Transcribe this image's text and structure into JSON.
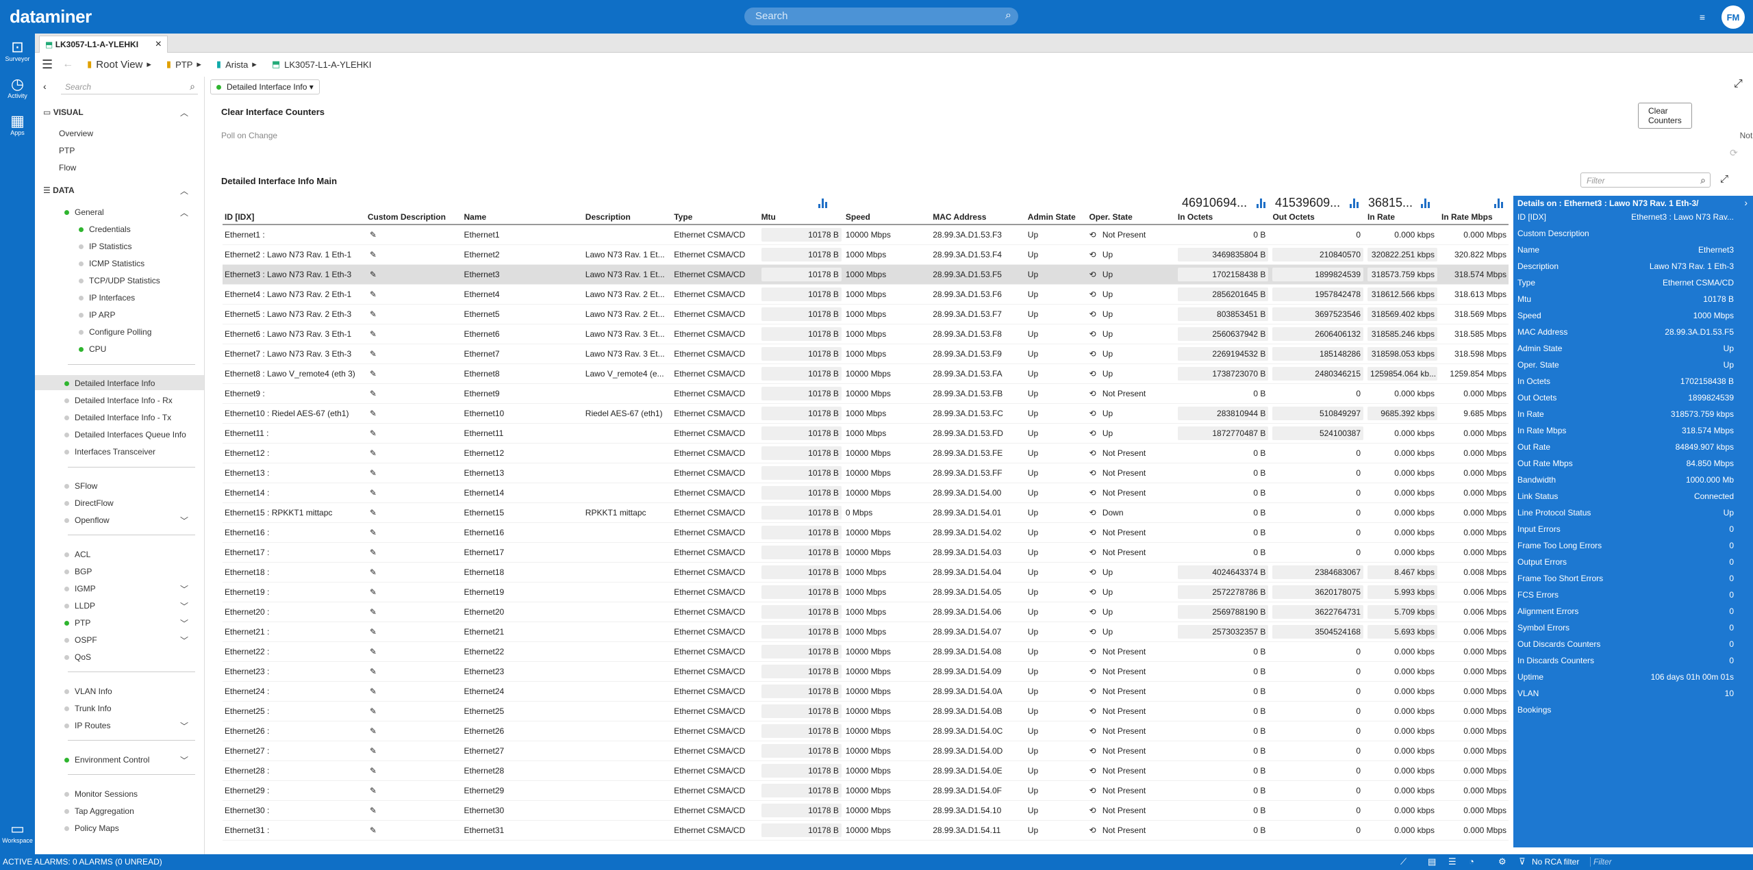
{
  "app": {
    "brand": "dataminer",
    "search_placeholder": "Search",
    "user_initials": "FM"
  },
  "rail": [
    {
      "label": "Surveyor"
    },
    {
      "label": "Activity"
    },
    {
      "label": "Apps"
    },
    {
      "label": "Workspace"
    }
  ],
  "tab": {
    "label": "LK3057-L1-A-YLEHKI"
  },
  "breadcrumb": [
    "Root View",
    "PTP",
    "Arista",
    "LK3057-L1-A-YLEHKI"
  ],
  "left": {
    "search_placeholder": "Search",
    "visual_header": "VISUAL",
    "visual_items": [
      "Overview",
      "PTP",
      "Flow"
    ],
    "data_header": "DATA",
    "general": "General",
    "general_items": [
      "Credentials",
      "IP Statistics",
      "ICMP Statistics",
      "TCP/UDP Statistics",
      "IP Interfaces",
      "IP ARP",
      "Configure Polling",
      "CPU"
    ],
    "detail_items": [
      "Detailed Interface Info",
      "Detailed Interface Info - Rx",
      "Detailed Interface Info - Tx",
      "Detailed Interfaces Queue Info",
      "Interfaces Transceiver"
    ],
    "flow_items": [
      "SFlow",
      "DirectFlow",
      "Openflow"
    ],
    "proto_items": [
      "ACL",
      "BGP",
      "IGMP",
      "LLDP",
      "PTP",
      "OSPF",
      "QoS"
    ],
    "vlan_items": [
      "VLAN Info",
      "Trunk Info",
      "IP Routes"
    ],
    "env_item": "Environment Control",
    "mon_items": [
      "Monitor Sessions",
      "Tap Aggregation",
      "Policy Maps"
    ]
  },
  "content": {
    "page_dropdown": "Detailed Interface Info",
    "clear_title": "Clear Interface Counters",
    "clear_button": "Clear Counters",
    "poll_label": "Poll on Change",
    "poll_value": "Not initialized",
    "table_title": "Detailed Interface Info Main",
    "filter_placeholder": "Filter",
    "totals": {
      "in_octets": "46910694...",
      "out_octets": "41539609...",
      "in_rate": "36815..."
    },
    "columns": [
      "ID [IDX]",
      "Custom Description",
      "Name",
      "Description",
      "Type",
      "Mtu",
      "Speed",
      "MAC Address",
      "Admin State",
      "Oper. State",
      "In Octets",
      "Out Octets",
      "In Rate",
      "In Rate Mbps"
    ],
    "rows": [
      [
        "Ethernet1 :",
        "",
        "Ethernet1",
        "",
        "Ethernet CSMA/CD",
        "10178 B",
        "10000 Mbps",
        "28.99.3A.D1.53.F3",
        "Up",
        "Not Present",
        "0 B",
        "0",
        "0.000 kbps",
        "0.000 Mbps"
      ],
      [
        "Ethernet2 : Lawo N73 Rav. 1 Eth-1",
        "",
        "Ethernet2",
        "Lawo N73 Rav. 1 Et...",
        "Ethernet CSMA/CD",
        "10178 B",
        "1000 Mbps",
        "28.99.3A.D1.53.F4",
        "Up",
        "Up",
        "3469835804 B",
        "210840570",
        "320822.251 kbps",
        "320.822 Mbps"
      ],
      [
        "Ethernet3 : Lawo N73 Rav. 1 Eth-3",
        "",
        "Ethernet3",
        "Lawo N73 Rav. 1 Et...",
        "Ethernet CSMA/CD",
        "10178 B",
        "1000 Mbps",
        "28.99.3A.D1.53.F5",
        "Up",
        "Up",
        "1702158438 B",
        "1899824539",
        "318573.759 kbps",
        "318.574 Mbps"
      ],
      [
        "Ethernet4 : Lawo N73 Rav. 2 Eth-1",
        "",
        "Ethernet4",
        "Lawo N73 Rav. 2 Et...",
        "Ethernet CSMA/CD",
        "10178 B",
        "1000 Mbps",
        "28.99.3A.D1.53.F6",
        "Up",
        "Up",
        "2856201645 B",
        "1957842478",
        "318612.566 kbps",
        "318.613 Mbps"
      ],
      [
        "Ethernet5 : Lawo N73 Rav. 2 Eth-3",
        "",
        "Ethernet5",
        "Lawo N73 Rav. 2 Et...",
        "Ethernet CSMA/CD",
        "10178 B",
        "1000 Mbps",
        "28.99.3A.D1.53.F7",
        "Up",
        "Up",
        "803853451 B",
        "3697523546",
        "318569.402 kbps",
        "318.569 Mbps"
      ],
      [
        "Ethernet6 : Lawo N73 Rav. 3 Eth-1",
        "",
        "Ethernet6",
        "Lawo N73 Rav. 3 Et...",
        "Ethernet CSMA/CD",
        "10178 B",
        "1000 Mbps",
        "28.99.3A.D1.53.F8",
        "Up",
        "Up",
        "2560637942 B",
        "2606406132",
        "318585.246 kbps",
        "318.585 Mbps"
      ],
      [
        "Ethernet7 : Lawo N73 Rav. 3 Eth-3",
        "",
        "Ethernet7",
        "Lawo N73 Rav. 3 Et...",
        "Ethernet CSMA/CD",
        "10178 B",
        "1000 Mbps",
        "28.99.3A.D1.53.F9",
        "Up",
        "Up",
        "2269194532 B",
        "185148286",
        "318598.053 kbps",
        "318.598 Mbps"
      ],
      [
        "Ethernet8 : Lawo V_remote4 (eth 3)",
        "",
        "Ethernet8",
        "Lawo V_remote4 (e...",
        "Ethernet CSMA/CD",
        "10178 B",
        "10000 Mbps",
        "28.99.3A.D1.53.FA",
        "Up",
        "Up",
        "1738723070 B",
        "2480346215",
        "1259854.064 kb...",
        "1259.854 Mbps"
      ],
      [
        "Ethernet9 :",
        "",
        "Ethernet9",
        "",
        "Ethernet CSMA/CD",
        "10178 B",
        "10000 Mbps",
        "28.99.3A.D1.53.FB",
        "Up",
        "Not Present",
        "0 B",
        "0",
        "0.000 kbps",
        "0.000 Mbps"
      ],
      [
        "Ethernet10 : Riedel AES-67 (eth1)",
        "",
        "Ethernet10",
        "Riedel AES-67 (eth1)",
        "Ethernet CSMA/CD",
        "10178 B",
        "1000 Mbps",
        "28.99.3A.D1.53.FC",
        "Up",
        "Up",
        "283810944 B",
        "510849297",
        "9685.392 kbps",
        "9.685 Mbps"
      ],
      [
        "Ethernet11 :",
        "",
        "Ethernet11",
        "",
        "Ethernet CSMA/CD",
        "10178 B",
        "1000 Mbps",
        "28.99.3A.D1.53.FD",
        "Up",
        "Up",
        "1872770487 B",
        "524100387",
        "0.000 kbps",
        "0.000 Mbps"
      ],
      [
        "Ethernet12 :",
        "",
        "Ethernet12",
        "",
        "Ethernet CSMA/CD",
        "10178 B",
        "10000 Mbps",
        "28.99.3A.D1.53.FE",
        "Up",
        "Not Present",
        "0 B",
        "0",
        "0.000 kbps",
        "0.000 Mbps"
      ],
      [
        "Ethernet13 :",
        "",
        "Ethernet13",
        "",
        "Ethernet CSMA/CD",
        "10178 B",
        "10000 Mbps",
        "28.99.3A.D1.53.FF",
        "Up",
        "Not Present",
        "0 B",
        "0",
        "0.000 kbps",
        "0.000 Mbps"
      ],
      [
        "Ethernet14 :",
        "",
        "Ethernet14",
        "",
        "Ethernet CSMA/CD",
        "10178 B",
        "10000 Mbps",
        "28.99.3A.D1.54.00",
        "Up",
        "Not Present",
        "0 B",
        "0",
        "0.000 kbps",
        "0.000 Mbps"
      ],
      [
        "Ethernet15 : RPKKT1 mittapc",
        "",
        "Ethernet15",
        "RPKKT1 mittapc",
        "Ethernet CSMA/CD",
        "10178 B",
        "0 Mbps",
        "28.99.3A.D1.54.01",
        "Up",
        "Down",
        "0 B",
        "0",
        "0.000 kbps",
        "0.000 Mbps"
      ],
      [
        "Ethernet16 :",
        "",
        "Ethernet16",
        "",
        "Ethernet CSMA/CD",
        "10178 B",
        "10000 Mbps",
        "28.99.3A.D1.54.02",
        "Up",
        "Not Present",
        "0 B",
        "0",
        "0.000 kbps",
        "0.000 Mbps"
      ],
      [
        "Ethernet17 :",
        "",
        "Ethernet17",
        "",
        "Ethernet CSMA/CD",
        "10178 B",
        "10000 Mbps",
        "28.99.3A.D1.54.03",
        "Up",
        "Not Present",
        "0 B",
        "0",
        "0.000 kbps",
        "0.000 Mbps"
      ],
      [
        "Ethernet18 :",
        "",
        "Ethernet18",
        "",
        "Ethernet CSMA/CD",
        "10178 B",
        "1000 Mbps",
        "28.99.3A.D1.54.04",
        "Up",
        "Up",
        "4024643374 B",
        "2384683067",
        "8.467 kbps",
        "0.008 Mbps"
      ],
      [
        "Ethernet19 :",
        "",
        "Ethernet19",
        "",
        "Ethernet CSMA/CD",
        "10178 B",
        "1000 Mbps",
        "28.99.3A.D1.54.05",
        "Up",
        "Up",
        "2572278786 B",
        "3620178075",
        "5.993 kbps",
        "0.006 Mbps"
      ],
      [
        "Ethernet20 :",
        "",
        "Ethernet20",
        "",
        "Ethernet CSMA/CD",
        "10178 B",
        "1000 Mbps",
        "28.99.3A.D1.54.06",
        "Up",
        "Up",
        "2569788190 B",
        "3622764731",
        "5.709 kbps",
        "0.006 Mbps"
      ],
      [
        "Ethernet21 :",
        "",
        "Ethernet21",
        "",
        "Ethernet CSMA/CD",
        "10178 B",
        "1000 Mbps",
        "28.99.3A.D1.54.07",
        "Up",
        "Up",
        "2573032357 B",
        "3504524168",
        "5.693 kbps",
        "0.006 Mbps"
      ],
      [
        "Ethernet22 :",
        "",
        "Ethernet22",
        "",
        "Ethernet CSMA/CD",
        "10178 B",
        "10000 Mbps",
        "28.99.3A.D1.54.08",
        "Up",
        "Not Present",
        "0 B",
        "0",
        "0.000 kbps",
        "0.000 Mbps"
      ],
      [
        "Ethernet23 :",
        "",
        "Ethernet23",
        "",
        "Ethernet CSMA/CD",
        "10178 B",
        "10000 Mbps",
        "28.99.3A.D1.54.09",
        "Up",
        "Not Present",
        "0 B",
        "0",
        "0.000 kbps",
        "0.000 Mbps"
      ],
      [
        "Ethernet24 :",
        "",
        "Ethernet24",
        "",
        "Ethernet CSMA/CD",
        "10178 B",
        "10000 Mbps",
        "28.99.3A.D1.54.0A",
        "Up",
        "Not Present",
        "0 B",
        "0",
        "0.000 kbps",
        "0.000 Mbps"
      ],
      [
        "Ethernet25 :",
        "",
        "Ethernet25",
        "",
        "Ethernet CSMA/CD",
        "10178 B",
        "10000 Mbps",
        "28.99.3A.D1.54.0B",
        "Up",
        "Not Present",
        "0 B",
        "0",
        "0.000 kbps",
        "0.000 Mbps"
      ],
      [
        "Ethernet26 :",
        "",
        "Ethernet26",
        "",
        "Ethernet CSMA/CD",
        "10178 B",
        "10000 Mbps",
        "28.99.3A.D1.54.0C",
        "Up",
        "Not Present",
        "0 B",
        "0",
        "0.000 kbps",
        "0.000 Mbps"
      ],
      [
        "Ethernet27 :",
        "",
        "Ethernet27",
        "",
        "Ethernet CSMA/CD",
        "10178 B",
        "10000 Mbps",
        "28.99.3A.D1.54.0D",
        "Up",
        "Not Present",
        "0 B",
        "0",
        "0.000 kbps",
        "0.000 Mbps"
      ],
      [
        "Ethernet28 :",
        "",
        "Ethernet28",
        "",
        "Ethernet CSMA/CD",
        "10178 B",
        "10000 Mbps",
        "28.99.3A.D1.54.0E",
        "Up",
        "Not Present",
        "0 B",
        "0",
        "0.000 kbps",
        "0.000 Mbps"
      ],
      [
        "Ethernet29 :",
        "",
        "Ethernet29",
        "",
        "Ethernet CSMA/CD",
        "10178 B",
        "10000 Mbps",
        "28.99.3A.D1.54.0F",
        "Up",
        "Not Present",
        "0 B",
        "0",
        "0.000 kbps",
        "0.000 Mbps"
      ],
      [
        "Ethernet30 :",
        "",
        "Ethernet30",
        "",
        "Ethernet CSMA/CD",
        "10178 B",
        "10000 Mbps",
        "28.99.3A.D1.54.10",
        "Up",
        "Not Present",
        "0 B",
        "0",
        "0.000 kbps",
        "0.000 Mbps"
      ],
      [
        "Ethernet31 :",
        "",
        "Ethernet31",
        "",
        "Ethernet CSMA/CD",
        "10178 B",
        "10000 Mbps",
        "28.99.3A.D1.54.11",
        "Up",
        "Not Present",
        "0 B",
        "0",
        "0.000 kbps",
        "0.000 Mbps"
      ]
    ],
    "selected_row": 2
  },
  "details": {
    "title": "Details on : Ethernet3 : Lawo N73 Rav. 1 Eth-3/",
    "fields": [
      [
        "ID [IDX]",
        "Ethernet3 : Lawo N73 Rav..."
      ],
      [
        "Custom Description",
        ""
      ],
      [
        "Name",
        "Ethernet3"
      ],
      [
        "Description",
        "Lawo N73 Rav. 1 Eth-3"
      ],
      [
        "Type",
        "Ethernet CSMA/CD"
      ],
      [
        "Mtu",
        "10178 B"
      ],
      [
        "Speed",
        "1000 Mbps"
      ],
      [
        "MAC Address",
        "28.99.3A.D1.53.F5"
      ],
      [
        "Admin State",
        "Up"
      ],
      [
        "Oper. State",
        "Up"
      ],
      [
        "In Octets",
        "1702158438 B"
      ],
      [
        "Out Octets",
        "1899824539"
      ],
      [
        "In Rate",
        "318573.759 kbps"
      ],
      [
        "In Rate Mbps",
        "318.574 Mbps"
      ],
      [
        "Out Rate",
        "84849.907 kbps"
      ],
      [
        "Out Rate Mbps",
        "84.850 Mbps"
      ],
      [
        "Bandwidth",
        "1000.000 Mb"
      ],
      [
        "Link Status",
        "Connected"
      ],
      [
        "Line Protocol Status",
        "Up"
      ],
      [
        "Input Errors",
        "0"
      ],
      [
        "Frame Too Long Errors",
        "0"
      ],
      [
        "Output Errors",
        "0"
      ],
      [
        "Frame Too Short Errors",
        "0"
      ],
      [
        "FCS Errors",
        "0"
      ],
      [
        "Alignment Errors",
        "0"
      ],
      [
        "Symbol Errors",
        "0"
      ],
      [
        "Out Discards Counters",
        "0"
      ],
      [
        "In Discards Counters",
        "0"
      ],
      [
        "Uptime",
        "106 days 01h 00m 01s"
      ],
      [
        "VLAN",
        "10"
      ],
      [
        "Bookings",
        ""
      ]
    ]
  },
  "status": {
    "alarms": "ACTIVE ALARMS: 0 ALARMS (0 UNREAD)",
    "rca": "No RCA filter",
    "filter_placeholder": "Filter"
  },
  "colors": {
    "brand": "#0f6fc6",
    "details_bg": "#1d78d1",
    "ok_dot": "#2fb52f"
  }
}
